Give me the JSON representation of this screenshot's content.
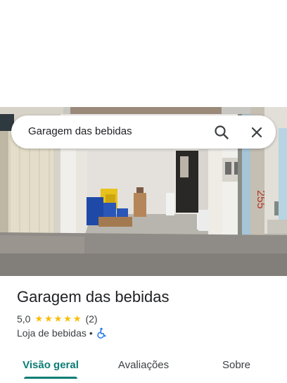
{
  "search": {
    "query": "Garagem das bebidas",
    "search_icon": "search-icon",
    "close_icon": "close-icon"
  },
  "hero_photo": {
    "sign_text": "255"
  },
  "place": {
    "name": "Garagem das bebidas",
    "rating": "5,0",
    "stars_filled": 5,
    "stars_total": 5,
    "review_count": "(2)",
    "category": "Loja de bebidas",
    "separator": "•",
    "accessibility_icon": "wheelchair-icon"
  },
  "tabs": [
    {
      "label": "Visão geral",
      "active": true
    },
    {
      "label": "Avaliações",
      "active": false
    },
    {
      "label": "Sobre",
      "active": false
    }
  ],
  "colors": {
    "accent": "#0b7d74",
    "star": "#fbbc04",
    "accessibility": "#1a73e8"
  }
}
